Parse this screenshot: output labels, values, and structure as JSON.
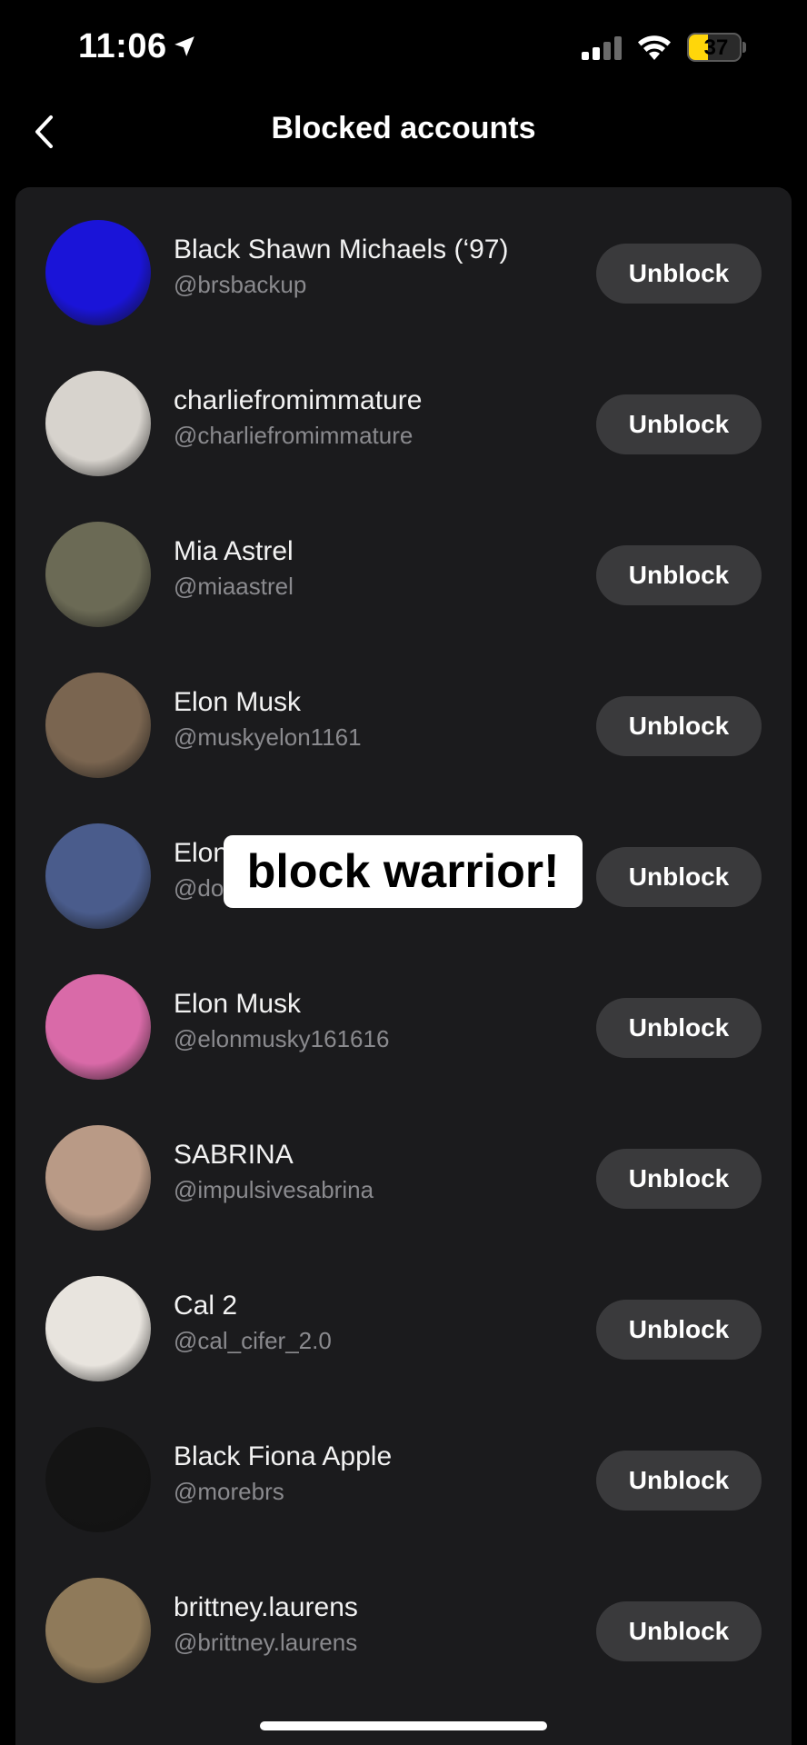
{
  "status_bar": {
    "time": "11:06",
    "battery_level": "37",
    "battery_fraction": 0.37,
    "icons": [
      "location-arrow-icon",
      "cellular-signal-icon",
      "wifi-icon",
      "battery-icon"
    ]
  },
  "header": {
    "back_icon": "chevron-left-icon",
    "title": "Blocked accounts"
  },
  "accounts": [
    {
      "name": "Black Shawn Michaels (‘97)",
      "handle": "@brsbackup",
      "button": "Unblock",
      "avatar_color": "#1a14d8"
    },
    {
      "name": "charliefromimmature",
      "handle": "@charliefromimmature",
      "button": "Unblock",
      "avatar_color": "#d7d3cd"
    },
    {
      "name": "Mia Astrel",
      "handle": "@miaastrel",
      "button": "Unblock",
      "avatar_color": "#6b6a55"
    },
    {
      "name": "Elon Musk",
      "handle": "@muskyelon1161",
      "button": "Unblock",
      "avatar_color": "#7a6550"
    },
    {
      "name": "Elon Musk",
      "handle": "@do",
      "button": "Unblock",
      "avatar_color": "#4a5c8c"
    },
    {
      "name": "Elon Musk",
      "handle": "@elonmusky161616",
      "button": "Unblock",
      "avatar_color": "#d96aa8"
    },
    {
      "name": "SABRINA",
      "handle": "@impulsivesabrina",
      "button": "Unblock",
      "avatar_color": "#b99a86"
    },
    {
      "name": "Cal 2",
      "handle": "@cal_cifer_2.0",
      "button": "Unblock",
      "avatar_color": "#e8e4de"
    },
    {
      "name": "Black Fiona Apple",
      "handle": "@morebrs",
      "button": "Unblock",
      "avatar_color": "#141414"
    },
    {
      "name": "brittney.laurens",
      "handle": "@brittney.laurens",
      "button": "Unblock",
      "avatar_color": "#8f7a5a"
    }
  ],
  "overlay_caption": "block warrior!"
}
